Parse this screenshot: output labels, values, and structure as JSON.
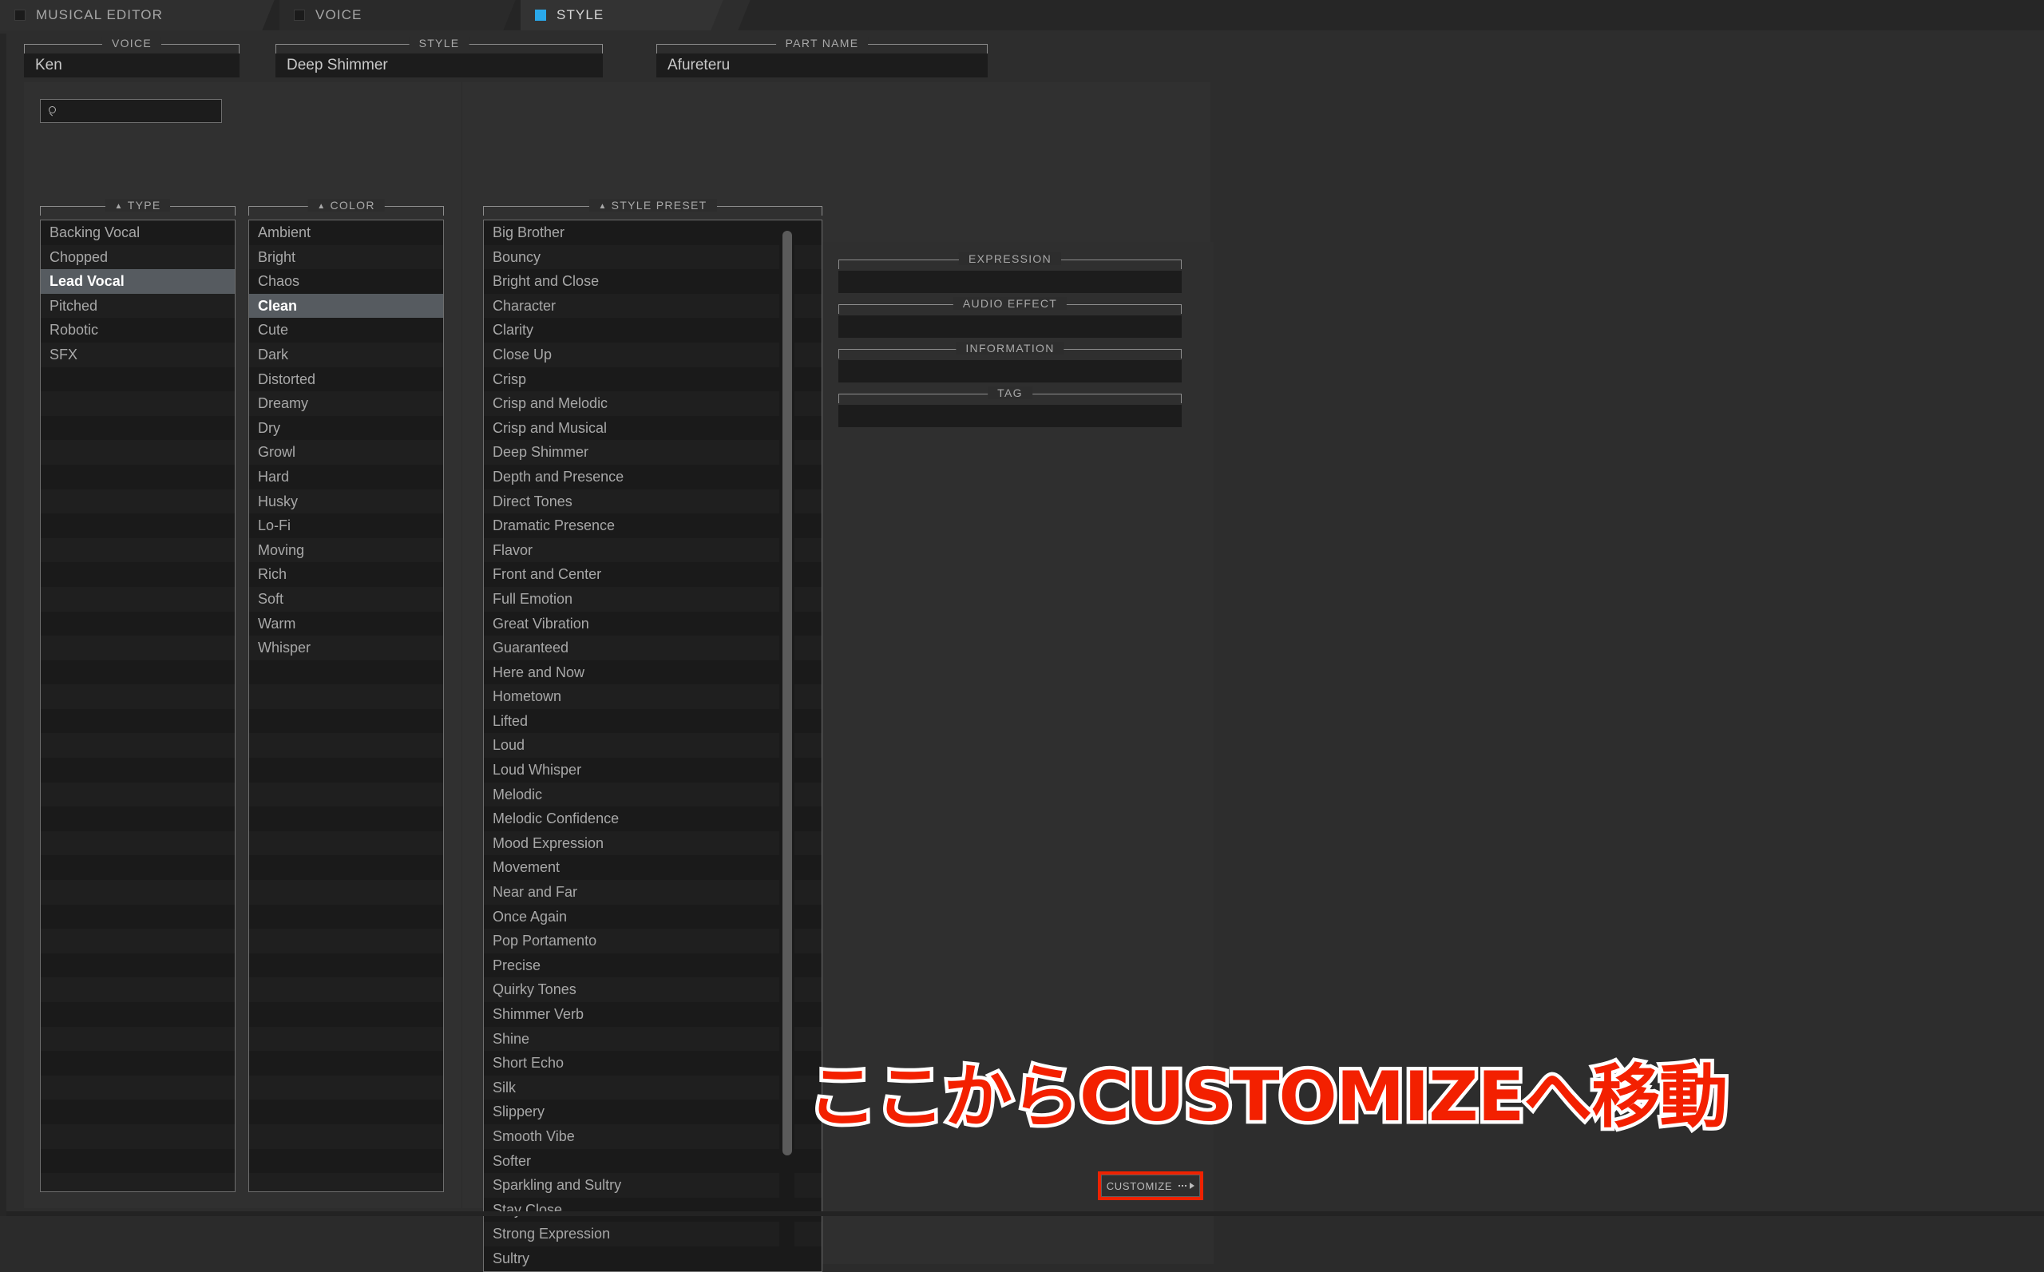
{
  "app": {
    "accent_blue": "#2aa8ea",
    "annotation_red": "#f32000",
    "highlight_red": "#ee2200"
  },
  "tabs": [
    {
      "label": "MUSICAL EDITOR",
      "active": false
    },
    {
      "label": "VOICE",
      "active": false
    },
    {
      "label": "STYLE",
      "active": true
    }
  ],
  "header_fields": [
    {
      "caption": "VOICE",
      "value": "Ken"
    },
    {
      "caption": "STYLE",
      "value": "Deep Shimmer"
    },
    {
      "caption": "PART NAME",
      "value": "Afureteru"
    }
  ],
  "search": {
    "value": "",
    "placeholder": ""
  },
  "type_list": {
    "caption": "TYPE",
    "sort_arrow": "▲",
    "selected": "Lead Vocal",
    "items": [
      "Backing Vocal",
      "Chopped",
      "Lead Vocal",
      "Pitched",
      "Robotic",
      "SFX"
    ]
  },
  "color_list": {
    "caption": "COLOR",
    "sort_arrow": "▲",
    "selected": "Clean",
    "items": [
      "Ambient",
      "Bright",
      "Chaos",
      "Clean",
      "Cute",
      "Dark",
      "Distorted",
      "Dreamy",
      "Dry",
      "Growl",
      "Hard",
      "Husky",
      "Lo-Fi",
      "Moving",
      "Rich",
      "Soft",
      "Warm",
      "Whisper"
    ]
  },
  "style_preset_list": {
    "caption": "STYLE PRESET",
    "sort_arrow": "▲",
    "selected": "",
    "items": [
      "Big Brother",
      "Bouncy",
      "Bright and Close",
      "Character",
      "Clarity",
      "Close Up",
      "Crisp",
      "Crisp and Melodic",
      "Crisp and Musical",
      "Deep Shimmer",
      "Depth and Presence",
      "Direct Tones",
      "Dramatic Presence",
      "Flavor",
      "Front and Center",
      "Full Emotion",
      "Great Vibration",
      "Guaranteed",
      "Here and Now",
      "Hometown",
      "Lifted",
      "Loud",
      "Loud Whisper",
      "Melodic",
      "Melodic Confidence",
      "Mood Expression",
      "Movement",
      "Near and Far",
      "Once Again",
      "Pop Portamento",
      "Precise",
      "Quirky Tones",
      "Shimmer Verb",
      "Shine",
      "Short Echo",
      "Silk",
      "Slippery",
      "Smooth Vibe",
      "Softer",
      "Sparkling and Sultry",
      "Stay Close",
      "Strong Expression",
      "Sultry"
    ]
  },
  "detail_fields": [
    {
      "caption": "EXPRESSION",
      "value": ""
    },
    {
      "caption": "AUDIO EFFECT",
      "value": ""
    },
    {
      "caption": "INFORMATION",
      "value": ""
    },
    {
      "caption": "TAG",
      "value": ""
    }
  ],
  "customize_button": {
    "label": "CUSTOMIZE",
    "highlighted": true
  },
  "annotation": {
    "text": "ここからCUSTOMIZEへ移動"
  }
}
